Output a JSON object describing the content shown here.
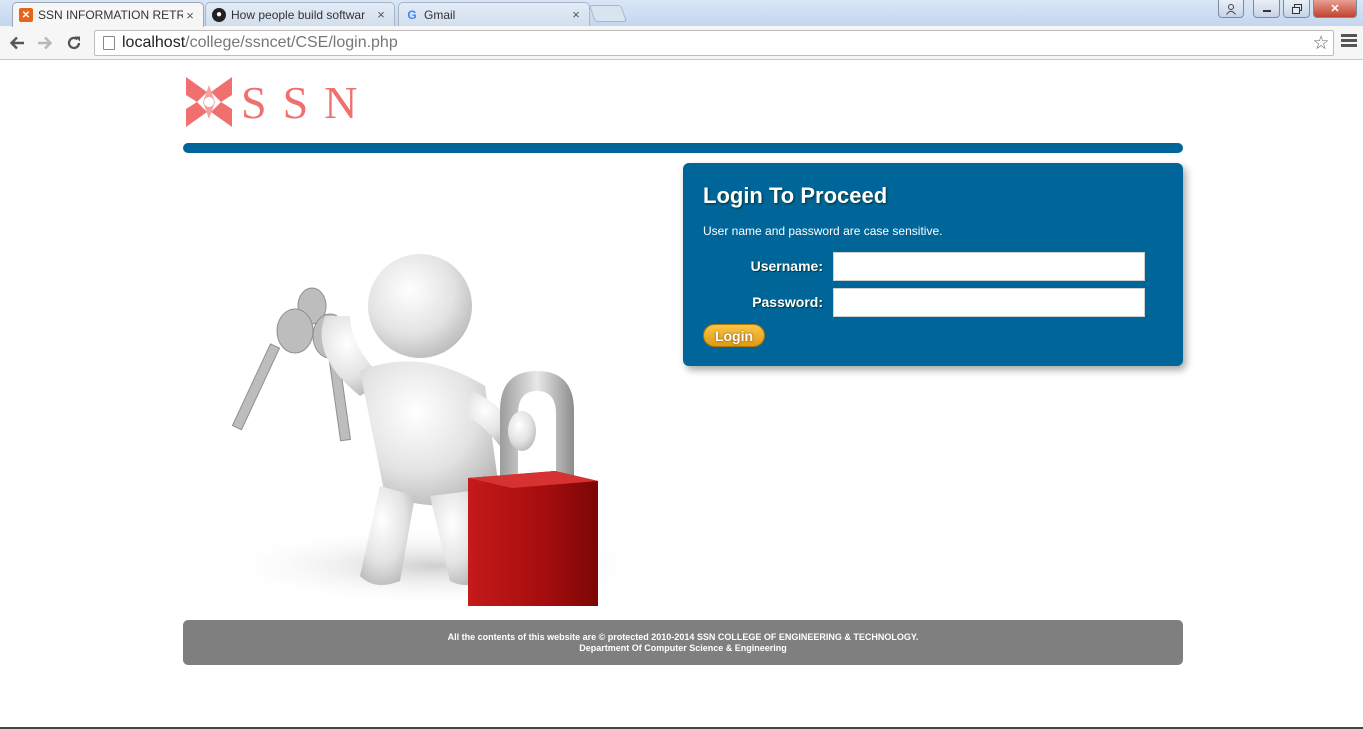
{
  "browser": {
    "tabs": [
      {
        "title": "SSN INFORMATION RETRI",
        "icon": "xampp-icon",
        "active": true
      },
      {
        "title": "How people build softwar",
        "icon": "github-icon",
        "active": false
      },
      {
        "title": "Gmail",
        "icon": "google-icon",
        "active": false
      }
    ],
    "url_host": "localhost",
    "url_path": "/college/ssncet/CSE/login.php"
  },
  "page": {
    "logo_text": "SSN",
    "login": {
      "title": "Login To Proceed",
      "note": "User name and password are case sensitive.",
      "username_label": "Username:",
      "password_label": "Password:",
      "username_value": "",
      "password_value": "",
      "button_label": "Login"
    },
    "footer": {
      "line1": "All the contents of this website are © protected 2010-2014 SSN COLLEGE OF ENGINEERING & TECHNOLOGY.",
      "line2": "Department Of Computer Science & Engineering"
    },
    "colors": {
      "brand_blue": "#006699",
      "logo_pink": "#f07070",
      "button_orange": "#e8a420",
      "footer_gray": "#7f7f7f"
    }
  }
}
